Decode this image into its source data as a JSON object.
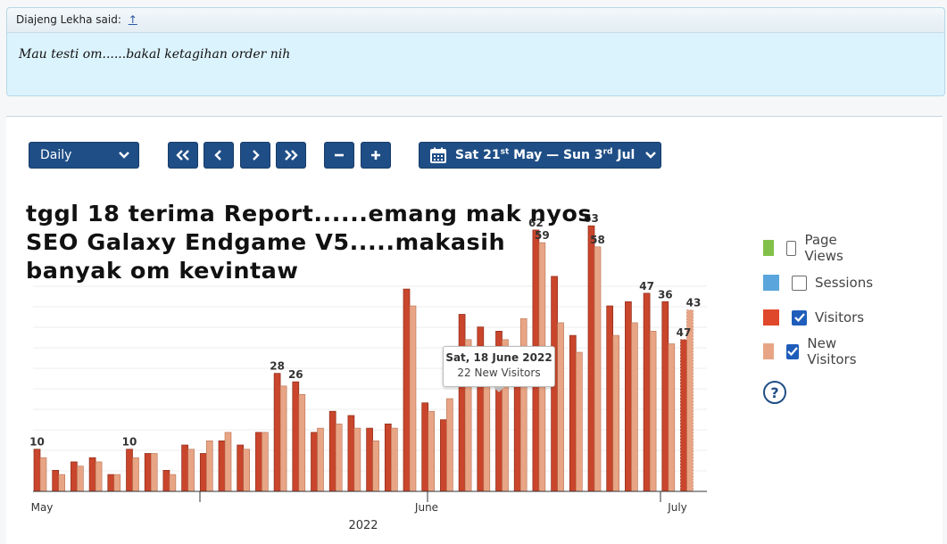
{
  "quote": {
    "author_text": "Diajeng Lekha said:",
    "arrow": "↑",
    "body": "Mau testi om......bakal ketagihan order nih"
  },
  "toolbar": {
    "period_label": "Daily",
    "nav": [
      "«",
      "‹",
      "›",
      "»"
    ],
    "zoom": [
      "−",
      "+"
    ],
    "range_start": "Sat 21",
    "range_start_sup": "st",
    "range_mid": " May — Sun 3",
    "range_end_sup": "rd",
    "range_end": " Jul"
  },
  "overlay_text": [
    "tggl 18 terima Report......emang mak nyos",
    "SEO Galaxy Endgame V5.....makasih",
    "banyak om kevintaw"
  ],
  "legend": [
    {
      "label": "Page Views",
      "color": "#83c04a",
      "checked": false
    },
    {
      "label": "Sessions",
      "color": "#5aa6dc",
      "checked": false
    },
    {
      "label": "Visitors",
      "color": "#e0482b",
      "checked": true
    },
    {
      "label": "New Visitors",
      "color": "#e8a585",
      "checked": true
    }
  ],
  "tooltip": {
    "date": "Sat, 18 June 2022",
    "value": "22 New Visitors"
  },
  "chart_data": {
    "type": "bar",
    "x_labels": [
      "May",
      "June",
      "July"
    ],
    "year_label": "2022",
    "colors": {
      "visitors": "#c9452c",
      "new_visitors": "#e8a585"
    },
    "series": [
      {
        "name": "Visitors",
        "values": [
          10,
          5,
          7,
          8,
          4,
          10,
          9,
          5,
          11,
          9,
          12,
          11,
          14,
          28,
          26,
          14,
          19,
          18,
          15,
          16,
          48,
          21,
          17,
          42,
          39,
          38,
          31,
          62,
          51,
          37,
          63,
          44,
          45,
          47,
          45,
          36
        ]
      },
      {
        "name": "New Visitors",
        "values": [
          8,
          4,
          6,
          7,
          4,
          8,
          9,
          4,
          10,
          12,
          14,
          10,
          14,
          25,
          23,
          15,
          16,
          15,
          12,
          15,
          44,
          19,
          22,
          36,
          34,
          36,
          41,
          59,
          40,
          33,
          58,
          37,
          40,
          38,
          35,
          43
        ]
      }
    ],
    "data_labels": [
      {
        "day": 0,
        "series": "Visitors",
        "text": "10"
      },
      {
        "day": 5,
        "series": "Visitors",
        "text": "10"
      },
      {
        "day": 13,
        "series": "Visitors",
        "text": "28"
      },
      {
        "day": 14,
        "series": "Visitors",
        "text": "26"
      },
      {
        "day": 27,
        "series": "Visitors",
        "text": "62"
      },
      {
        "day": 27,
        "series": "New Visitors",
        "text": "59"
      },
      {
        "day": 30,
        "series": "Visitors",
        "text": "63"
      },
      {
        "day": 30,
        "series": "New Visitors",
        "text": "58"
      },
      {
        "day": 33,
        "series": "Visitors",
        "text": "47"
      },
      {
        "day": 34,
        "series": "Visitors",
        "text": "36"
      },
      {
        "day": 35,
        "series": "Visitors",
        "text": "47"
      },
      {
        "day": 35,
        "series": "New Visitors",
        "text": "43"
      }
    ],
    "ylim": [
      0,
      66
    ],
    "grid": true
  }
}
